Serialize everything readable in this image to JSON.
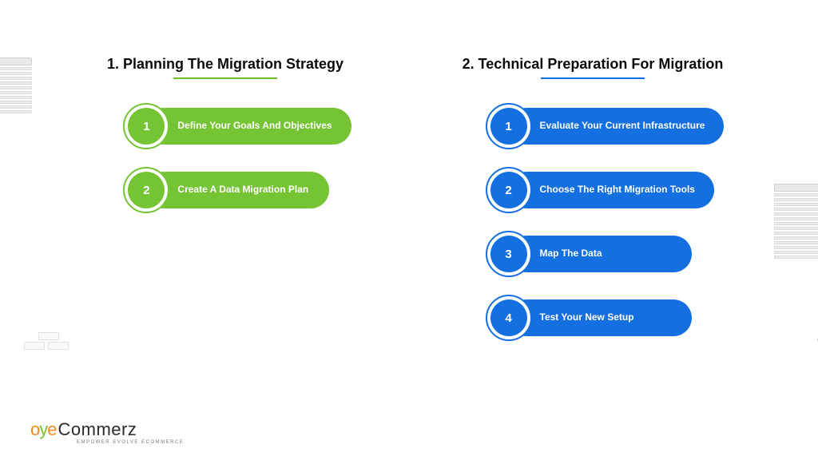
{
  "columns": [
    {
      "title": "1.  Planning The Migration Strategy",
      "color": "green",
      "steps": [
        {
          "num": "1",
          "label": "Define Your Goals And Objectives"
        },
        {
          "num": "2",
          "label": "Create A Data Migration Plan"
        }
      ]
    },
    {
      "title": "2.  Technical Preparation For Migration",
      "color": "blue",
      "steps": [
        {
          "num": "1",
          "label": "Evaluate Your Current Infrastructure"
        },
        {
          "num": "2",
          "label": "Choose The Right Migration Tools"
        },
        {
          "num": "3",
          "label": "Map The Data"
        },
        {
          "num": "4",
          "label": "Test Your New Setup"
        }
      ]
    }
  ],
  "logo": {
    "o": "o",
    "y": "y",
    "e": "e",
    "commerz": "Commerz",
    "tagline": "EMPOWER EVOLVE ECOMMERCE"
  },
  "colors": {
    "green": "#75c433",
    "blue": "#146fe0",
    "logo_orange": "#f28a1d",
    "logo_green": "#7bbf2e",
    "logo_dark": "#2b2b2b"
  }
}
